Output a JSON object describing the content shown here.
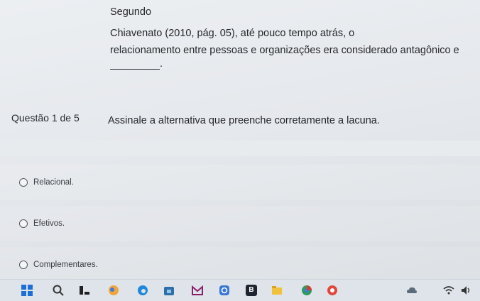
{
  "question": {
    "line1": "Segundo",
    "line2": "Chiavenato (2010, pág. 05), até pouco tempo atrás, o",
    "line3": "relacionamento entre pessoas e organizações era considerado antagônico e",
    "blank_end": ".",
    "meta": "Questão 1 de 5",
    "prompt": "Assinale a alternativa que preenche corretamente a lacuna."
  },
  "options": [
    {
      "label": "Relacional."
    },
    {
      "label": "Efetivos."
    },
    {
      "label": "Complementares."
    }
  ],
  "taskbar": {
    "icons": [
      "windows-start-icon",
      "search-icon",
      "task-view-icon",
      "widgets-icon",
      "edge-browser-icon",
      "store-icon",
      "mail-icon",
      "instagram-icon",
      "app-b-icon",
      "file-explorer-icon",
      "chrome-icon",
      "wifi-icon"
    ],
    "badge": "B"
  }
}
